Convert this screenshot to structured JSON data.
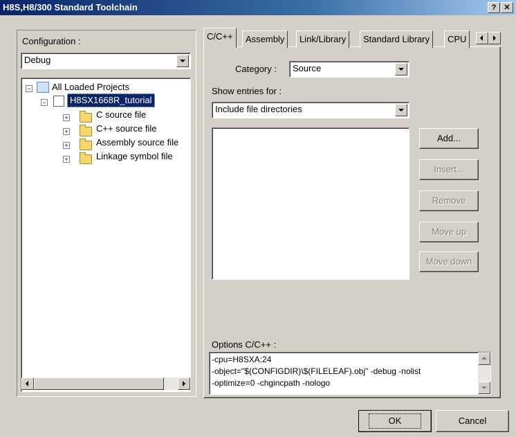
{
  "window": {
    "title": "H8S,H8/300 Standard Toolchain",
    "help_label": "?",
    "close_label": "✕"
  },
  "left": {
    "config_label": "Configuration :",
    "config_value": "Debug",
    "tree": {
      "root": "All Loaded Projects",
      "project": "H8SX1668R_tutorial",
      "folders": [
        "C source file",
        "C++ source file",
        "Assembly source file",
        "Linkage symbol file"
      ]
    }
  },
  "tabs": [
    "C/C++",
    "Assembly",
    "Link/Library",
    "Standard Library",
    "CPU"
  ],
  "category": {
    "label": "Category :",
    "value": "Source"
  },
  "entries": {
    "label": "Show entries for :",
    "value": "Include file directories"
  },
  "side_buttons": [
    "Add...",
    "Insert...",
    "Remove",
    "Move up",
    "Move down"
  ],
  "options": {
    "label": "Options C/C++ :",
    "lines": [
      "-cpu=H8SXA:24",
      "-object=\"$(CONFIGDIR)\\$(FILELEAF).obj\" -debug -nolist",
      "-optimize=0 -chgincpath -nologo"
    ]
  },
  "footer": {
    "ok": "OK",
    "cancel": "Cancel"
  }
}
